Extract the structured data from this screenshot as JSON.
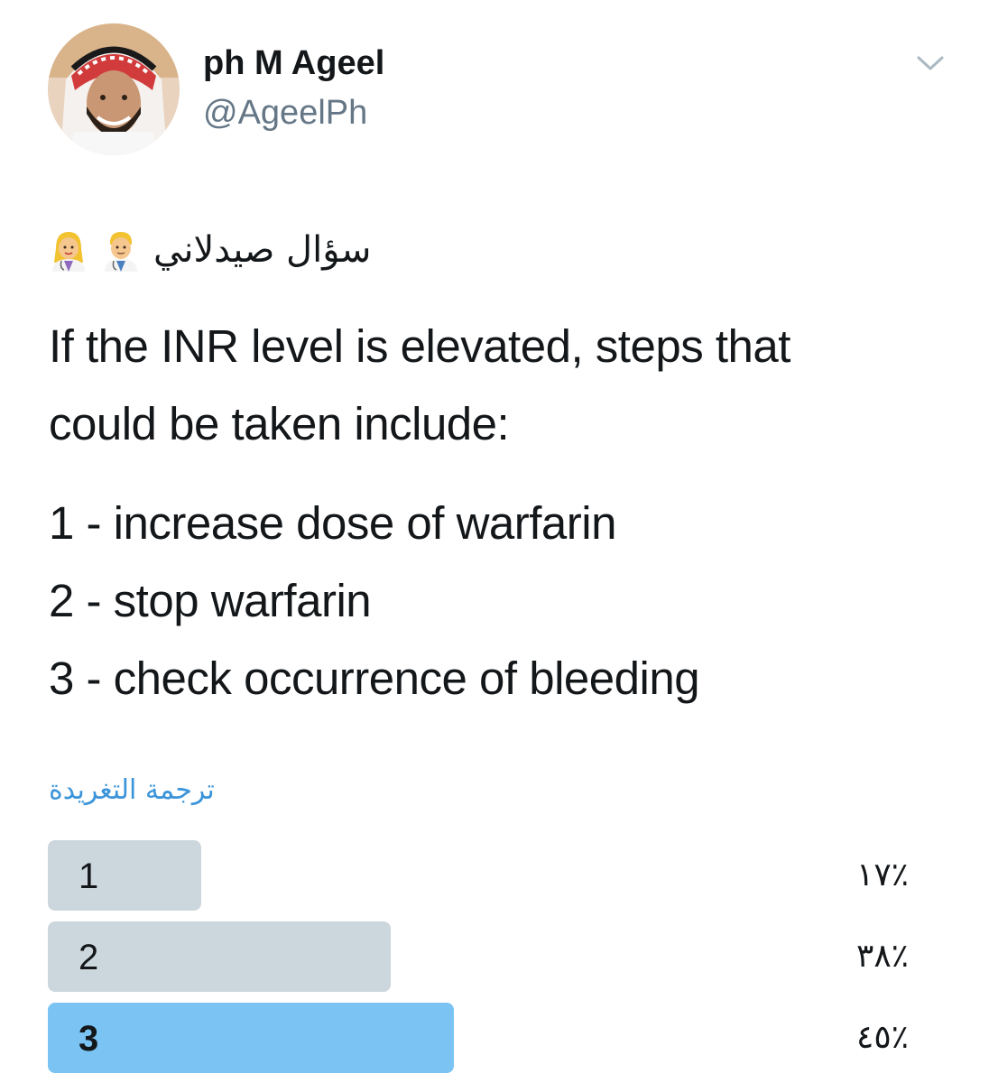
{
  "author": {
    "display_name": "ph M Ageel",
    "handle": "@AgeelPh"
  },
  "tweet": {
    "arabic_heading": "سؤال صيدلاني",
    "emojis": [
      "woman-health-worker-emoji",
      "man-health-worker-emoji"
    ],
    "text_line_1": "If the INR level is elevated, steps that",
    "text_line_2": "could be taken include:",
    "items": [
      "1 -  increase dose of warfarin",
      "2 - stop warfarin",
      "3 - check occurrence of bleeding"
    ],
    "translate_label": "ترجمة التغريدة"
  },
  "poll": {
    "options": [
      {
        "label": "1",
        "percent_text": "٪١٧",
        "percent": 17,
        "winner": false
      },
      {
        "label": "2",
        "percent_text": "٪٣٨",
        "percent": 38,
        "winner": false
      },
      {
        "label": "3",
        "percent_text": "٪٤٥",
        "percent": 45,
        "winner": true
      }
    ],
    "colors": {
      "bar": "#ccd6dd",
      "winner_bar": "#7ac3f2",
      "link": "#3b94d9"
    }
  }
}
